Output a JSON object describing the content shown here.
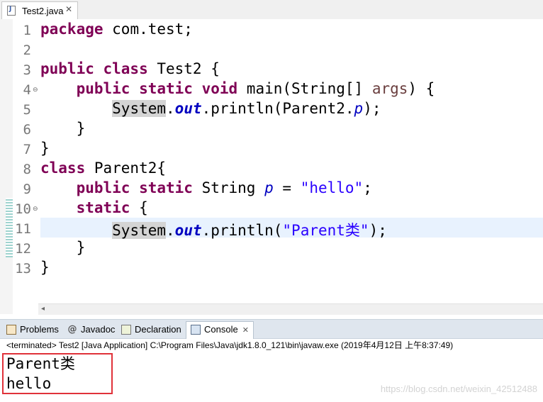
{
  "editor": {
    "tab_title": "Test2.java",
    "tab_icon": "java-file-icon",
    "lines": [
      {
        "num": "1"
      },
      {
        "num": "2"
      },
      {
        "num": "3"
      },
      {
        "num": "4"
      },
      {
        "num": "5"
      },
      {
        "num": "6"
      },
      {
        "num": "7"
      },
      {
        "num": "8"
      },
      {
        "num": "9"
      },
      {
        "num": "10"
      },
      {
        "num": "11"
      },
      {
        "num": "12"
      },
      {
        "num": "13"
      }
    ],
    "code": {
      "l1_kw": "package",
      "l1_rest": " com.test;",
      "l3_kw": "public class",
      "l3_rest": " Test2 {",
      "l4_indent": "    ",
      "l4_kw": "public static void",
      "l4_mid": " main(String[] ",
      "l4_param": "args",
      "l4_end": ") {",
      "l5_indent": "        ",
      "l5_sys": "System",
      "l5_dot": ".",
      "l5_out": "out",
      "l5_mid": ".println(Parent2.",
      "l5_p": "p",
      "l5_end": ");",
      "l6": "    }",
      "l7": "}",
      "l8_kw": "class",
      "l8_rest": " Parent2{",
      "l9_indent": "    ",
      "l9_kw": "public static",
      "l9_mid": " String ",
      "l9_p": "p",
      "l9_eq": " = ",
      "l9_str": "\"hello\"",
      "l9_end": ";",
      "l10_indent": "    ",
      "l10_kw": "static",
      "l10_end": " {",
      "l11_indent": "        ",
      "l11_sys": "System",
      "l11_dot": ".",
      "l11_out": "out",
      "l11_mid": ".println(",
      "l11_str": "\"Parent类\"",
      "l11_end": ");",
      "l12": "    }",
      "l13": "}"
    }
  },
  "panel": {
    "tabs": [
      {
        "label": "Problems",
        "icon": "problems-icon"
      },
      {
        "label": "Javadoc",
        "icon": "javadoc-icon"
      },
      {
        "label": "Declaration",
        "icon": "declaration-icon"
      },
      {
        "label": "Console",
        "icon": "console-icon",
        "active": true
      }
    ],
    "status": "<terminated> Test2 [Java Application] C:\\Program Files\\Java\\jdk1.8.0_121\\bin\\javaw.exe (2019年4月12日 上午8:37:49)",
    "output": [
      "Parent类",
      "hello"
    ],
    "watermark": "https://blog.csdn.net/weixin_42512488"
  },
  "colors": {
    "keyword": "#7f0055",
    "string": "#2a00ff",
    "field": "#0000c0",
    "highlight_box": "#e0323a"
  }
}
